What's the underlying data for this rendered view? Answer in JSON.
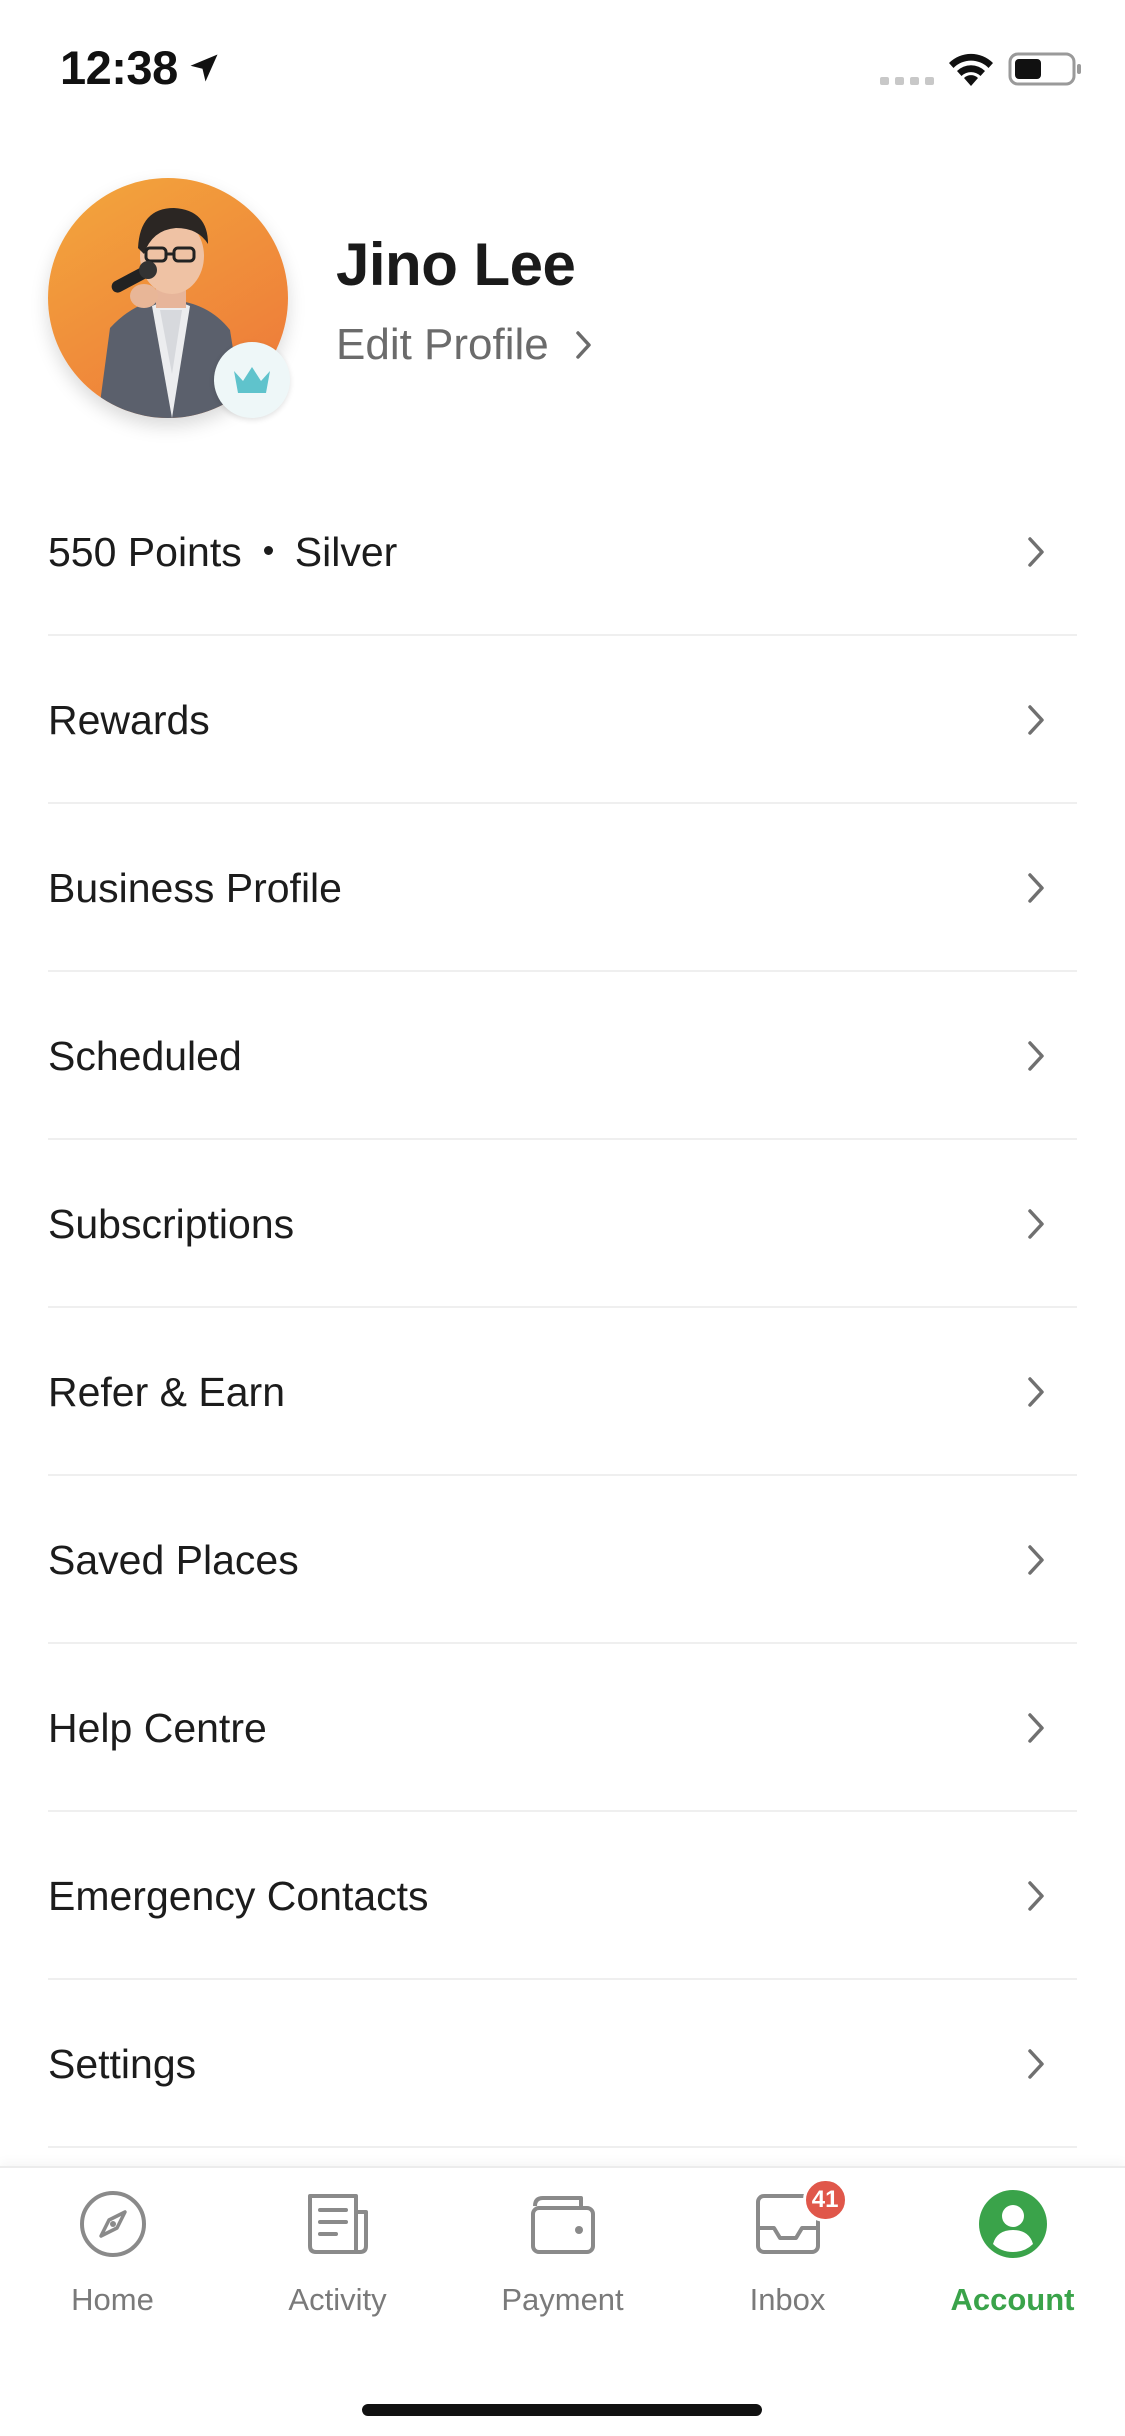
{
  "status_bar": {
    "time": "12:38"
  },
  "profile": {
    "name": "Jino Lee",
    "edit_label": "Edit Profile",
    "accent_color": "#f2a04a"
  },
  "menu": {
    "points": {
      "value": "550 Points",
      "tier": "Silver"
    },
    "items": [
      {
        "label": "Rewards"
      },
      {
        "label": "Business Profile"
      },
      {
        "label": "Scheduled"
      },
      {
        "label": "Subscriptions"
      },
      {
        "label": "Refer & Earn"
      },
      {
        "label": "Saved Places"
      },
      {
        "label": "Help Centre"
      },
      {
        "label": "Emergency Contacts"
      },
      {
        "label": "Settings"
      }
    ]
  },
  "bottom_nav": {
    "items": [
      {
        "label": "Home",
        "icon": "compass-icon"
      },
      {
        "label": "Activity",
        "icon": "receipt-icon"
      },
      {
        "label": "Payment",
        "icon": "wallet-icon"
      },
      {
        "label": "Inbox",
        "icon": "inbox-icon",
        "badge": "41"
      },
      {
        "label": "Account",
        "icon": "account-icon",
        "active": true
      }
    ],
    "active_color": "#3aa34a",
    "badge_color": "#e0574a"
  }
}
